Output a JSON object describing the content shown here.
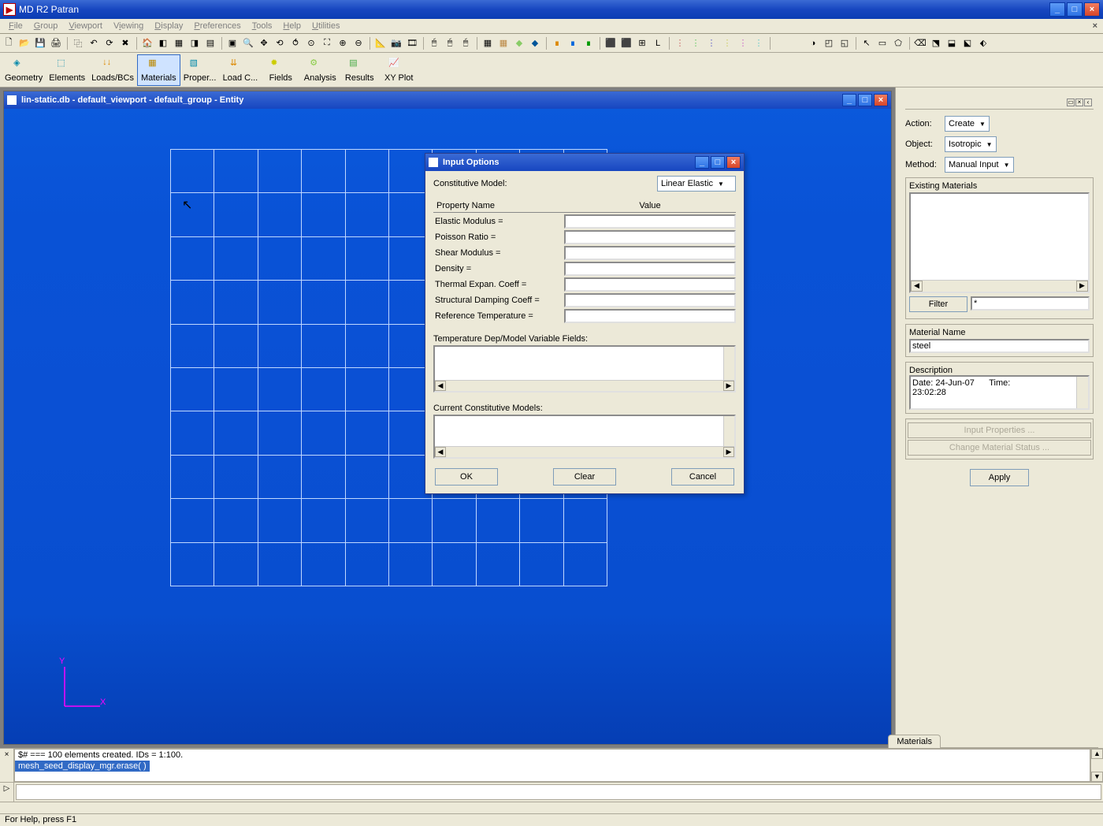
{
  "app": {
    "title": "MD R2 Patran"
  },
  "menu": {
    "file": "File",
    "group": "Group",
    "viewport": "Viewport",
    "viewing": "Viewing",
    "display": "Display",
    "preferences": "Preferences",
    "tools": "Tools",
    "help": "Help",
    "utilities": "Utilities"
  },
  "big_buttons": {
    "geometry": "Geometry",
    "elements": "Elements",
    "loadsbcs": "Loads/BCs",
    "materials": "Materials",
    "proper": "Proper...",
    "loadc": "Load C...",
    "fields": "Fields",
    "analysis": "Analysis",
    "results": "Results",
    "xyplot": "XY Plot"
  },
  "viewport": {
    "title": "lin-static.db - default_viewport - default_group - Entity"
  },
  "dialog": {
    "title": "Input Options",
    "constitutive_label": "Constitutive Model:",
    "constitutive_value": "Linear Elastic",
    "header_name": "Property Name",
    "header_value": "Value",
    "rows": {
      "elastic": "Elastic Modulus =",
      "poisson": "Poisson Ratio =",
      "shear": "Shear Modulus =",
      "density": "Density =",
      "thermal": "Thermal Expan. Coeff =",
      "damping": "Structural Damping Coeff =",
      "reftemp": "Reference Temperature ="
    },
    "temp_dep_label": "Temperature Dep/Model Variable Fields:",
    "current_models_label": "Current Constitutive Models:",
    "ok": "OK",
    "clear": "Clear",
    "cancel": "Cancel"
  },
  "panel": {
    "action_label": "Action:",
    "action_value": "Create",
    "object_label": "Object:",
    "object_value": "Isotropic",
    "method_label": "Method:",
    "method_value": "Manual Input",
    "existing_label": "Existing Materials",
    "filter_btn": "Filter",
    "filter_value": "*",
    "matname_label": "Material Name",
    "matname_value": "steel",
    "desc_label": "Description",
    "desc_date": "Date: 24-Jun-07",
    "desc_time_lbl": "Time:",
    "desc_time_val": "23:02:28",
    "input_props_btn": "Input Properties ...",
    "change_status_btn": "Change Material Status ...",
    "apply": "Apply",
    "tab": "Materials"
  },
  "console": {
    "line1": "$# === 100 elements created. IDs = 1:100.",
    "line2": "mesh_seed_display_mgr.erase(  )"
  },
  "status": {
    "text": "For Help, press F1"
  },
  "triad": {
    "x": "X",
    "y": "Y"
  }
}
